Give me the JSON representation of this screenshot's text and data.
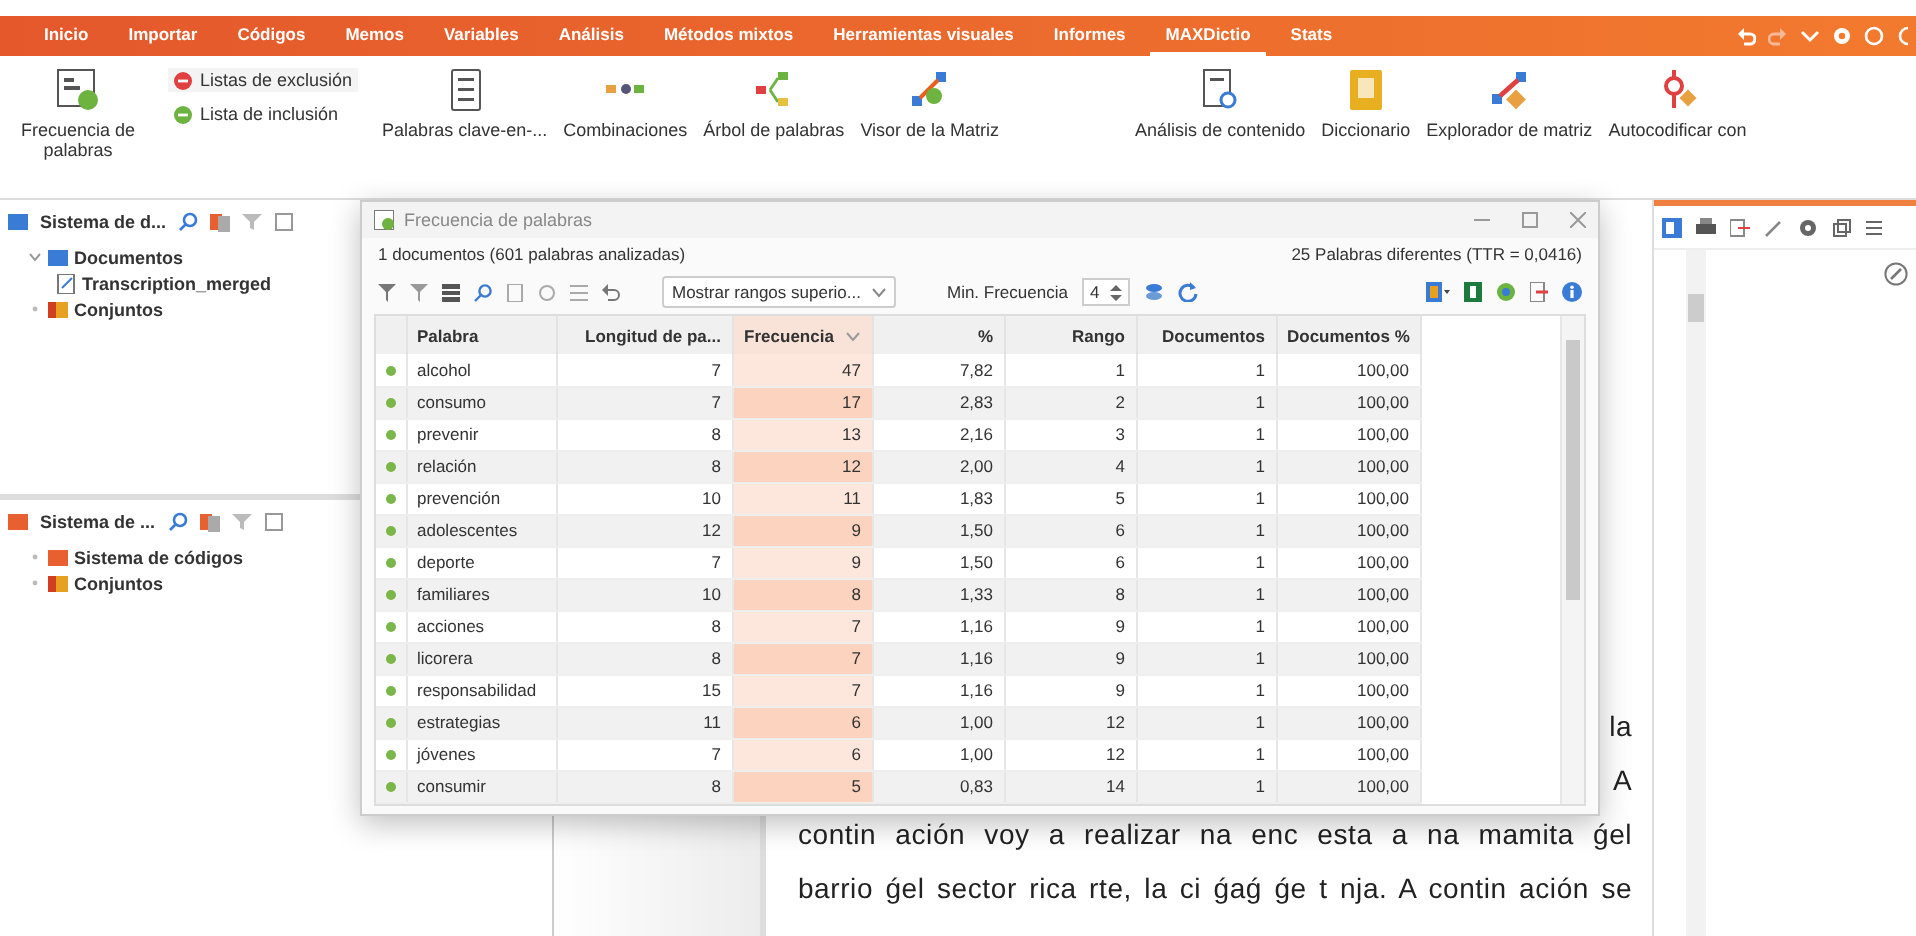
{
  "menu": {
    "tabs": [
      {
        "label": "Inicio",
        "selected": false
      },
      {
        "label": "Importar",
        "selected": false
      },
      {
        "label": "Códigos",
        "selected": false
      },
      {
        "label": "Memos",
        "selected": false
      },
      {
        "label": "Variables",
        "selected": false
      },
      {
        "label": "Análisis",
        "selected": false
      },
      {
        "label": "Métodos mixtos",
        "selected": false
      },
      {
        "label": "Herramientas visuales",
        "selected": false
      },
      {
        "label": "Informes",
        "selected": false
      },
      {
        "label": "MAXDictio",
        "selected": true
      },
      {
        "label": "Stats",
        "selected": false
      }
    ]
  },
  "ribbon": {
    "main_button": "Frecuencia de palabras",
    "small_buttons": [
      {
        "label": "Listas de exclusión",
        "kind": "exclude"
      },
      {
        "label": "Lista de inclusión",
        "kind": "include"
      }
    ],
    "buttons": [
      {
        "label": "Palabras clave-en-...",
        "kind": "list"
      },
      {
        "label": "Combinaciones",
        "kind": "combos"
      },
      {
        "label": "Árbol de palabras",
        "kind": "tree"
      },
      {
        "label": "Visor de la Matriz",
        "kind": "matrix"
      },
      {
        "label": "Análisis de contenido",
        "kind": "content"
      },
      {
        "label": "Diccionario",
        "kind": "dictionary"
      },
      {
        "label": "Explorador de matriz",
        "kind": "explorer"
      },
      {
        "label": "Autocodificar con",
        "kind": "autocode"
      }
    ]
  },
  "documents_pane": {
    "title": "Sistema de d...",
    "tree": [
      {
        "label": "Documentos",
        "kind": "folder",
        "expanded": true,
        "children": [
          {
            "label": "Transcription_merged",
            "kind": "document"
          }
        ]
      },
      {
        "label": "Conjuntos",
        "kind": "sets",
        "expanded": false
      }
    ]
  },
  "codes_pane": {
    "title": "Sistema de ...",
    "tree": [
      {
        "label": "Sistema de códigos",
        "kind": "codes",
        "expanded": false
      },
      {
        "label": "Conjuntos",
        "kind": "sets",
        "expanded": false
      }
    ]
  },
  "dialog": {
    "title": "Frecuencia de palabras",
    "summary": "1 documentos (601 palabras analizadas)",
    "types": "25 Palabras diferentes (TTR = 0,0416)",
    "range_filter": "Mostrar rangos superio...",
    "min_frequency_label": "Min. Frecuencia",
    "min_frequency": "4",
    "table": {
      "columns": [
        {
          "label": "Palabra",
          "sorted": false
        },
        {
          "label": "Longitud de pa...",
          "sorted": false
        },
        {
          "label": "Frecuencia",
          "sorted": true
        },
        {
          "label": "%",
          "sorted": false
        },
        {
          "label": "Rango",
          "sorted": false
        },
        {
          "label": "Documentos",
          "sorted": false
        },
        {
          "label": "Documentos %",
          "sorted": false
        }
      ],
      "rows": [
        {
          "cells": [
            "alcohol",
            "7",
            "47",
            "7,82",
            "1",
            "1",
            "100,00"
          ]
        },
        {
          "cells": [
            "consumo",
            "7",
            "17",
            "2,83",
            "2",
            "1",
            "100,00"
          ]
        },
        {
          "cells": [
            "prevenir",
            "8",
            "13",
            "2,16",
            "3",
            "1",
            "100,00"
          ]
        },
        {
          "cells": [
            "relación",
            "8",
            "12",
            "2,00",
            "4",
            "1",
            "100,00"
          ]
        },
        {
          "cells": [
            "prevención",
            "10",
            "11",
            "1,83",
            "5",
            "1",
            "100,00"
          ]
        },
        {
          "cells": [
            "adolescentes",
            "12",
            "9",
            "1,50",
            "6",
            "1",
            "100,00"
          ]
        },
        {
          "cells": [
            "deporte",
            "7",
            "9",
            "1,50",
            "6",
            "1",
            "100,00"
          ]
        },
        {
          "cells": [
            "familiares",
            "10",
            "8",
            "1,33",
            "8",
            "1",
            "100,00"
          ]
        },
        {
          "cells": [
            "acciones",
            "8",
            "7",
            "1,16",
            "9",
            "1",
            "100,00"
          ]
        },
        {
          "cells": [
            "licorera",
            "8",
            "7",
            "1,16",
            "9",
            "1",
            "100,00"
          ]
        },
        {
          "cells": [
            "responsabilidad",
            "15",
            "7",
            "1,16",
            "9",
            "1",
            "100,00"
          ]
        },
        {
          "cells": [
            "estrategias",
            "11",
            "6",
            "1,00",
            "12",
            "1",
            "100,00"
          ]
        },
        {
          "cells": [
            "jóvenes",
            "7",
            "6",
            "1,00",
            "12",
            "1",
            "100,00"
          ]
        },
        {
          "cells": [
            "consumir",
            "8",
            "5",
            "0,83",
            "14",
            "1",
            "100,00"
          ]
        }
      ]
    }
  },
  "document": {
    "lines": [
      {
        "text": "la",
        "kind": "fragment"
      },
      {
        "text": "A",
        "kind": "fragment"
      },
      {
        "text": "contin ación voy a realizar na enc esta a na mamita ǵel",
        "kind": "line"
      },
      {
        "text": "barrio ǵel sector rica rte, la ci ǵaǵ ǵe t nja. A contin ación se",
        "kind": "line"
      }
    ]
  }
}
